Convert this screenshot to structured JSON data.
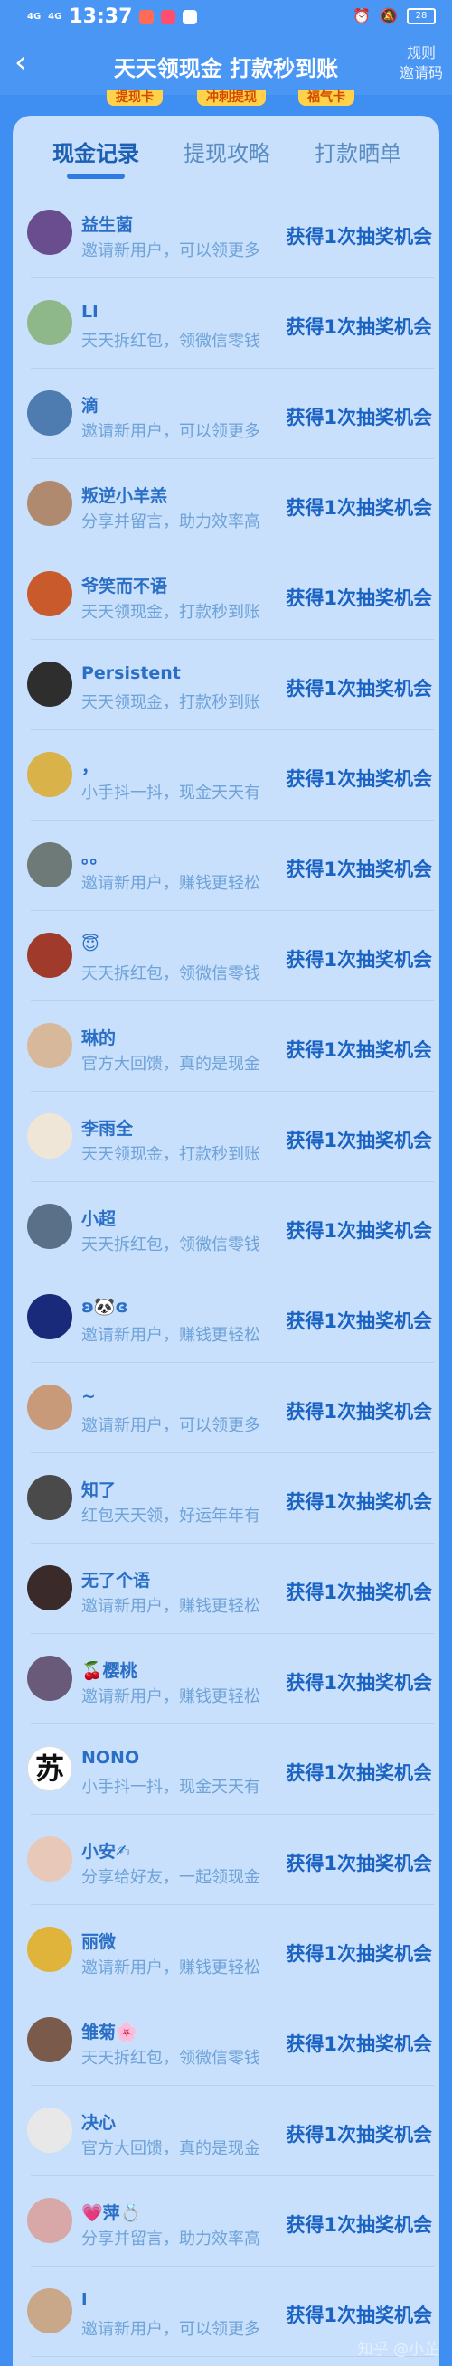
{
  "status_bar": {
    "network1": "4G",
    "network2": "4G",
    "time": "13:37",
    "battery": "28"
  },
  "nav": {
    "title": "天天领现金 打款秒到账",
    "right_line1": "规则",
    "right_line2": "邀请码"
  },
  "peek_badges": [
    "提现卡",
    "冲刺提现",
    "福气卡"
  ],
  "tabs": [
    "现金记录",
    "提现攻略",
    "打款晒单"
  ],
  "records": [
    {
      "name": "益生菌",
      "desc": "邀请新用户，可以领更多",
      "reward": "获得1次抽奖机会",
      "avatar_color": "#6a4d8f"
    },
    {
      "name": "Ll",
      "desc": "天天拆红包，领微信零钱",
      "reward": "获得1次抽奖机会",
      "avatar_color": "#8fb88a"
    },
    {
      "name": "滴",
      "desc": "邀请新用户，可以领更多",
      "reward": "获得1次抽奖机会",
      "avatar_color": "#4e7bb0"
    },
    {
      "name": "叛逆小羊羔",
      "desc": "分享并留言，助力效率高",
      "reward": "获得1次抽奖机会",
      "avatar_color": "#b08a6e"
    },
    {
      "name": "爷笑而不语",
      "desc": "天天领现金，打款秒到账",
      "reward": "获得1次抽奖机会",
      "avatar_color": "#c85a2c"
    },
    {
      "name": "Persistent",
      "desc": "天天领现金，打款秒到账",
      "reward": "获得1次抽奖机会",
      "avatar_color": "#2e2e2e"
    },
    {
      "name": "，",
      "desc": "小手抖一抖，现金天天有",
      "reward": "获得1次抽奖机会",
      "avatar_color": "#d9b24a"
    },
    {
      "name": "。。",
      "desc": "邀请新用户，赚钱更轻松",
      "reward": "获得1次抽奖机会",
      "avatar_color": "#6d7a78"
    },
    {
      "name": "😇",
      "desc": "天天拆红包，领微信零钱",
      "reward": "获得1次抽奖机会",
      "avatar_color": "#a03a2a"
    },
    {
      "name": "琳的",
      "desc": "官方大回馈，真的是现金",
      "reward": "获得1次抽奖机会",
      "avatar_color": "#d8b89a"
    },
    {
      "name": "李雨全",
      "desc": "天天领现金，打款秒到账",
      "reward": "获得1次抽奖机会",
      "avatar_color": "#f0e6d8"
    },
    {
      "name": "小超",
      "desc": "天天拆红包，领微信零钱",
      "reward": "获得1次抽奖机会",
      "avatar_color": "#5a6f88"
    },
    {
      "name": "ʚ🐼ɞ",
      "desc": "邀请新用户，赚钱更轻松",
      "reward": "获得1次抽奖机会",
      "avatar_color": "#1a2a7a"
    },
    {
      "name": "~",
      "desc": "邀请新用户，可以领更多",
      "reward": "获得1次抽奖机会",
      "avatar_color": "#c99a7a"
    },
    {
      "name": "知了",
      "desc": "红包天天领，好运年年有",
      "reward": "获得1次抽奖机会",
      "avatar_color": "#4a4a4a"
    },
    {
      "name": "无了个语",
      "desc": "邀请新用户，赚钱更轻松",
      "reward": "获得1次抽奖机会",
      "avatar_color": "#3a2a2a"
    },
    {
      "name": "🍒樱桃",
      "desc": "邀请新用户，赚钱更轻松",
      "reward": "获得1次抽奖机会",
      "avatar_color": "#6a5a7a"
    },
    {
      "name": "NONO",
      "desc": "小手抖一抖，现金天天有",
      "reward": "获得1次抽奖机会",
      "avatar_color": "#ffffff",
      "avatar_text": "苏"
    },
    {
      "name": "小安✍",
      "desc": "分享给好友，一起领现金",
      "reward": "获得1次抽奖机会",
      "avatar_color": "#e8c8b8"
    },
    {
      "name": "丽微",
      "desc": "邀请新用户，赚钱更轻松",
      "reward": "获得1次抽奖机会",
      "avatar_color": "#e0b43a"
    },
    {
      "name": "雏菊🌸",
      "desc": "天天拆红包，领微信零钱",
      "reward": "获得1次抽奖机会",
      "avatar_color": "#7a5a4a"
    },
    {
      "name": "决心",
      "desc": "官方大回馈，真的是现金",
      "reward": "获得1次抽奖机会",
      "avatar_color": "#e8e8e8"
    },
    {
      "name": "💗萍💍",
      "desc": "分享并留言，助力效率高",
      "reward": "获得1次抽奖机会",
      "avatar_color": "#d8a8a8"
    },
    {
      "name": "l",
      "desc": "邀请新用户，可以领更多",
      "reward": "获得1次抽奖机会",
      "avatar_color": "#c8a888"
    }
  ],
  "watermark": "知乎 @小芷",
  "colors": {
    "header_blue": "#4a96f5",
    "card_bg": "#c8e0fb",
    "name_blue": "#2a6ec6",
    "desc_blue": "#6fa2d8",
    "reward_blue": "#1b63c3"
  }
}
